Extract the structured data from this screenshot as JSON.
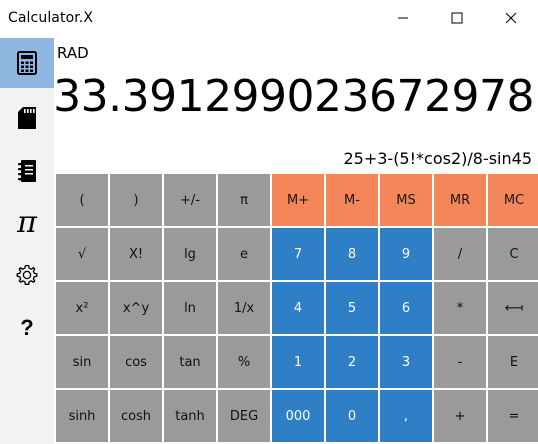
{
  "window": {
    "title": "Calculator.X"
  },
  "sidebar": {
    "items": [
      {
        "icon": "calculator-icon",
        "active": true
      },
      {
        "icon": "sd-card-icon",
        "active": false
      },
      {
        "icon": "notebook-icon",
        "active": false
      },
      {
        "icon": "pi-icon",
        "label": "π",
        "active": false
      },
      {
        "icon": "gear-icon",
        "active": false
      },
      {
        "icon": "help-icon",
        "label": "?",
        "active": false
      }
    ]
  },
  "display": {
    "mode": "RAD",
    "result": "33.391299023672978",
    "expression": "25+3-(5!*cos2)/8-sin45"
  },
  "keypad": {
    "rows": [
      [
        "(",
        ")",
        "+/-",
        "π",
        "M+",
        "M-",
        "MS",
        "MR",
        "MC"
      ],
      [
        "√",
        "X!",
        "lg",
        "e",
        "7",
        "8",
        "9",
        "/",
        "C"
      ],
      [
        "x²",
        "x^y",
        "ln",
        "1/x",
        "4",
        "5",
        "6",
        "*",
        "⟻"
      ],
      [
        "sin",
        "cos",
        "tan",
        "%",
        "1",
        "2",
        "3",
        "-",
        "E"
      ],
      [
        "sinh",
        "cosh",
        "tanh",
        "DEG",
        "000",
        "0",
        ",",
        "+",
        "="
      ]
    ]
  },
  "colors": {
    "gray_key": "#9a9a9a",
    "memory_key": "#f5865a",
    "digit_key": "#2f7fc6",
    "active_nav": "#8fb7df",
    "sidebar_bg": "#f2f2f2"
  }
}
